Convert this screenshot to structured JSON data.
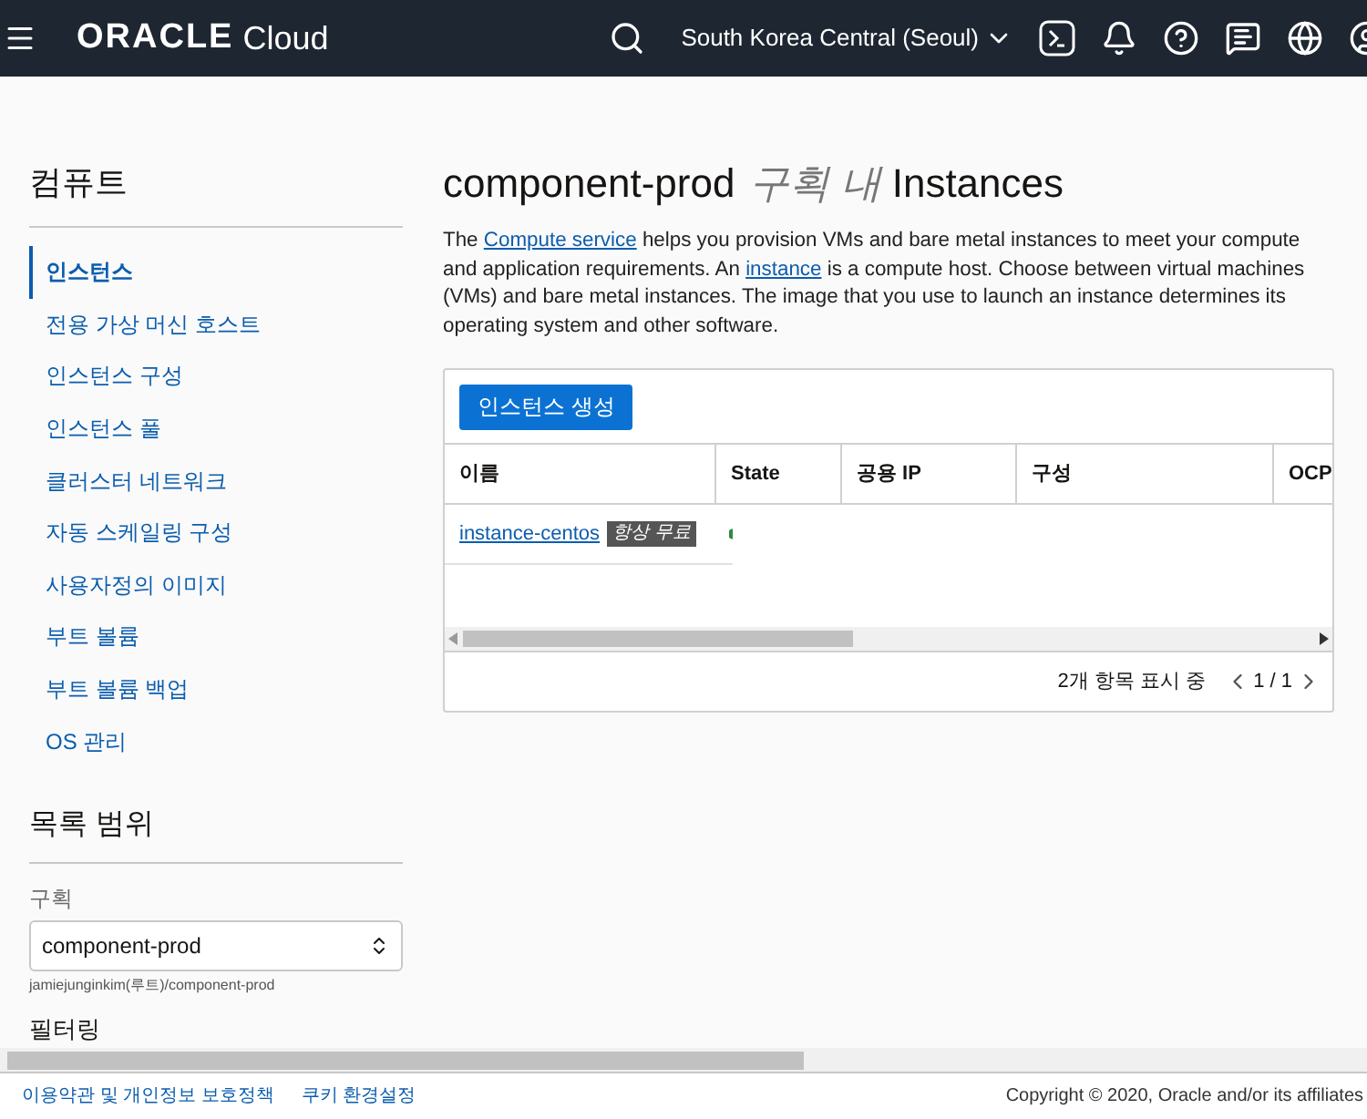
{
  "header": {
    "brand": "ORACLE",
    "product": "Cloud",
    "region": "South Korea Central (Seoul)"
  },
  "sidebar": {
    "title": "컴퓨트",
    "items": [
      {
        "label": "인스턴스",
        "selected": true
      },
      {
        "label": "전용 가상 머신 호스트",
        "selected": false
      },
      {
        "label": "인스턴스 구성",
        "selected": false
      },
      {
        "label": "인스턴스 풀",
        "selected": false
      },
      {
        "label": "클러스터 네트워크",
        "selected": false
      },
      {
        "label": "자동 스케일링 구성",
        "selected": false
      },
      {
        "label": "사용자정의 이미지",
        "selected": false
      },
      {
        "label": "부트 볼륨",
        "selected": false
      },
      {
        "label": "부트 볼륨 백업",
        "selected": false
      },
      {
        "label": "OS 관리",
        "selected": false
      }
    ],
    "scope_title": "목록 범위",
    "compartment_label": "구획",
    "compartment_value": "component-prod",
    "compartment_path": "jamiejunginkim(루트)/component-prod",
    "filter_title": "필터링"
  },
  "main": {
    "title": "component-prod",
    "title_middle": "구획 내",
    "title_end": "Instances",
    "description": [
      {
        "kind": "text",
        "text": "The "
      },
      {
        "kind": "link",
        "text": "Compute service"
      },
      {
        "kind": "text",
        "text": " helps you provision VMs and bare metal instances to meet your compute and application requirements. An "
      },
      {
        "kind": "link",
        "text": "instance"
      },
      {
        "kind": "text",
        "text": " is a compute host. Choose between virtual machines (VMs) and bare metal instances. The image that you use to launch an instance determines its operating system and other software."
      }
    ],
    "create_button": "인스턴스 생성",
    "table": {
      "columns": [
        "이름",
        "State",
        "공용 IP",
        "구성",
        "OCP"
      ],
      "rows": [
        {
          "name": "instance-centos",
          "badge": "항상 무료"
        }
      ]
    },
    "count": "2개 항목 표시 중",
    "page": "1 / 1"
  },
  "footer": {
    "links": [
      "이용약관 및 개인정보 보호정책",
      "쿠키 환경설정"
    ],
    "copyright": "Copyright © 2020, Oracle and/or its affiliates"
  }
}
